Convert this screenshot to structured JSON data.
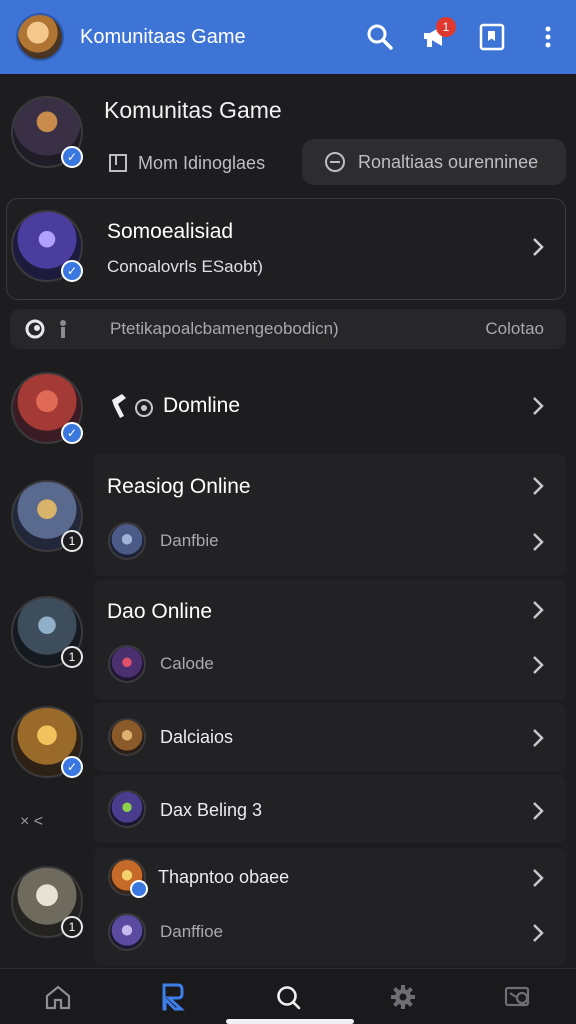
{
  "appbar": {
    "title": "Komunitaas Game",
    "notification_count": "1"
  },
  "header": {
    "title": "Komunitas Game",
    "tab_left_label": "Mom Idinoglaes",
    "tab_right_label": "Ronaltiaas ourenninee"
  },
  "featured_card": {
    "title": "Somoealisiad",
    "subtitle": "Conoalovrls ESaobt)"
  },
  "search_strip": {
    "text": "Ptetikapoalcbamengeobodicn)",
    "right_label": "Colotao"
  },
  "rows": [
    {
      "title": "Domline"
    },
    {
      "title": "Reasiog Online",
      "sub": "Danfbie",
      "badge": "1"
    },
    {
      "title": "Dao Online",
      "sub": "Calode",
      "badge": "1"
    },
    {
      "title": "Dalciaios"
    },
    {
      "title": "Dax Beling 3"
    },
    {
      "title": "Thapntoo obaee",
      "sub": "Danffioe",
      "badge": "1"
    }
  ],
  "side_marker": "× <",
  "icons": {
    "search": "search-icon",
    "notifications": "megaphone-icon",
    "bookmark": "bookmark-icon",
    "more": "more-vertical-icon",
    "home": "home-icon",
    "games": "controller-icon",
    "explore": "search-icon",
    "settings": "gear-icon",
    "messages": "messages-icon"
  },
  "colors": {
    "appbar": "#3e74d6",
    "accent": "#3a78e0",
    "background": "#1d1d1f",
    "badge": "#e0382f"
  }
}
